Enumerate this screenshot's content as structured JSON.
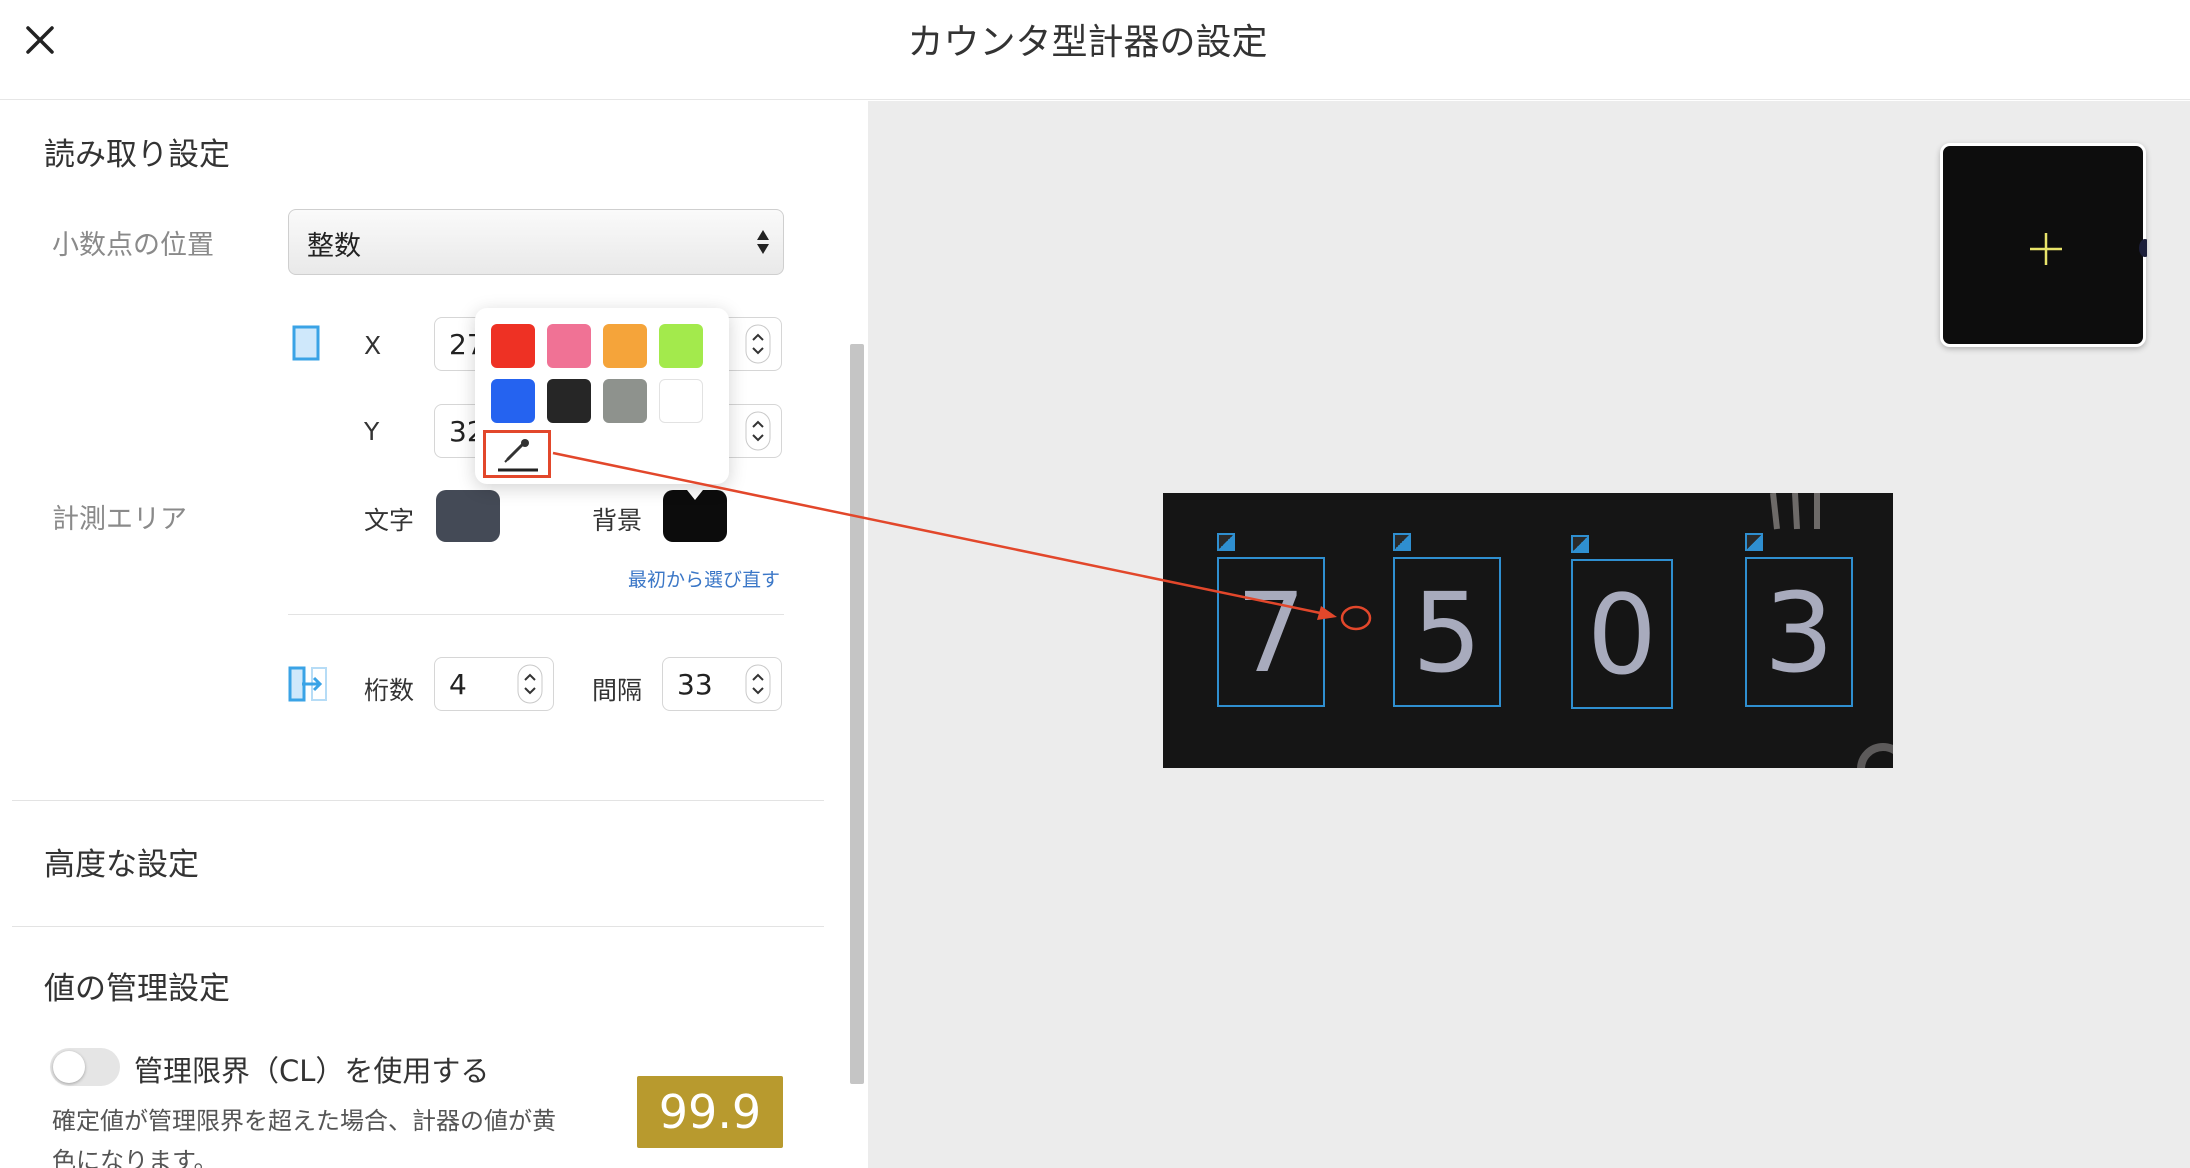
{
  "header": {
    "title": "カウンタ型計器の設定",
    "close_icon": "close-icon"
  },
  "reading": {
    "section_title": "読み取り設定",
    "decimal_label": "小数点の位置",
    "decimal_value": "整数",
    "area_label": "計測エリア",
    "x_label": "X",
    "x_value": "27",
    "y_label": "Y",
    "y_value": "32",
    "text_color_label": "文字",
    "bg_color_label": "背景",
    "reselect_link": "最初から選び直す",
    "digits_label": "桁数",
    "digits_value": "4",
    "spacing_label": "間隔",
    "spacing_value": "33"
  },
  "advanced": {
    "section_title": "高度な設定"
  },
  "value_mgmt": {
    "section_title": "値の管理設定",
    "cl_toggle_label": "管理限界（CL）を使用する",
    "cl_toggle_on": false,
    "description": "確定値が管理限界を超えた場合、計器の値が黄色になります。",
    "badge_value": "99.9"
  },
  "color_picker": {
    "colors": [
      "#ee3124",
      "#f07295",
      "#f5a43a",
      "#a3ea4c",
      "#2563f0",
      "#262626",
      "#8e928d",
      "#ffffff"
    ],
    "eyedropper_icon": "eyedropper-icon"
  },
  "preview": {
    "digits": [
      "7",
      "5",
      "0",
      "3"
    ],
    "minimap_icon": "crosshair-icon"
  },
  "colors": {
    "text_swatch": "#444a56",
    "bg_swatch": "#0c0c0c",
    "accent": "#2f8fd0",
    "annotation": "#e2472b",
    "badge": "#b89a2e"
  }
}
